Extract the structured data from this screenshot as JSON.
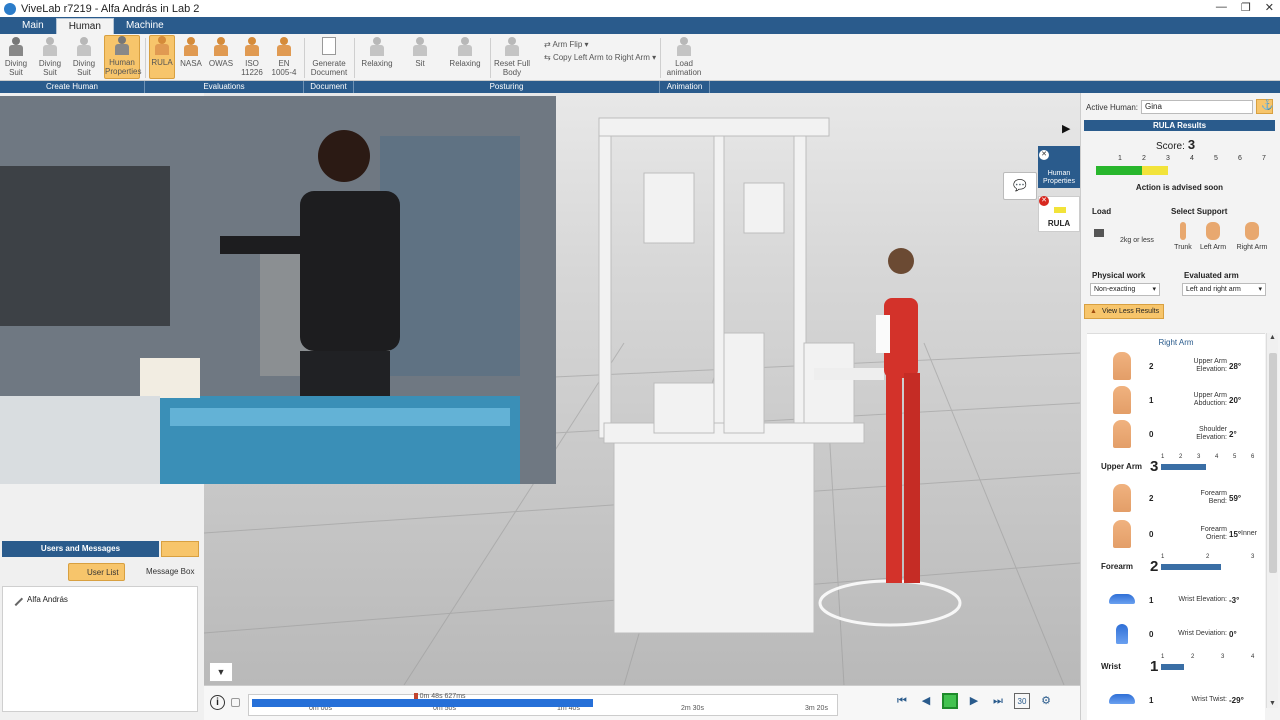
{
  "window": {
    "title": "ViveLab r7219 - Alfa András in Lab 2",
    "controls": [
      "—",
      "❐",
      "✕"
    ]
  },
  "tabs": [
    "Main",
    "Human",
    "Machine"
  ],
  "ribbon": {
    "create_human": [
      {
        "label": "Diving\nSuit"
      },
      {
        "label": "Diving\nSuit"
      },
      {
        "label": "Diving\nSuit"
      },
      {
        "label": "Human\nProperties"
      }
    ],
    "evaluations": [
      {
        "label": "RULA"
      },
      {
        "label": "NASA"
      },
      {
        "label": "OWAS"
      },
      {
        "label": "ISO\n11226"
      },
      {
        "label": "EN\n1005-4"
      }
    ],
    "document": [
      {
        "label": "Generate\nDocument"
      }
    ],
    "posturing": [
      {
        "label": "Relaxing"
      },
      {
        "label": "Sit"
      },
      {
        "label": "Relaxing"
      },
      {
        "label": "Reset Full\nBody"
      }
    ],
    "arm_flip_label": "Arm Flip",
    "copy_arm_label": "Copy Left Arm to Right Arm",
    "animation": [
      {
        "label": "Load\nanimation"
      }
    ]
  },
  "sections": [
    "Create Human",
    "Evaluations",
    "Document",
    "Posturing",
    "Animation"
  ],
  "users": {
    "header": "Users and Messages",
    "tabs": [
      "User List",
      "Message Box"
    ],
    "entries": [
      "Alfa András"
    ]
  },
  "timeline": {
    "current_time": "0m 48s 627ms",
    "ticks": [
      "0m 00s",
      "0m 50s",
      "1m 40s",
      "2m 30s",
      "3m 20s"
    ],
    "progress_fraction": 0.58,
    "playhead_fraction": 0.28,
    "speed_badge": "30"
  },
  "viewport_buttons": {
    "human_properties": "Human\nProperties",
    "rula": "RULA"
  },
  "rula": {
    "active_human_label": "Active Human:",
    "active_human": "Gina",
    "header": "RULA Results",
    "score_label": "Score:",
    "score": "3",
    "scale": [
      "1",
      "2",
      "3",
      "4",
      "5",
      "6",
      "7"
    ],
    "advice": "Action is advised soon",
    "load_label": "Load",
    "load_value": "2kg or less",
    "support_label": "Select Support",
    "supports": [
      "Trunk",
      "Left Arm",
      "Right Arm"
    ],
    "physical_work_label": "Physical work",
    "physical_work": "Non-exacting",
    "evaluated_arm_label": "Evaluated arm",
    "evaluated_arm": "Left and right arm",
    "view_less": "View Less Results",
    "section_title": "Right Arm",
    "rows": [
      {
        "score": "2",
        "label": "Upper Arm\nElevation:",
        "value": "28°",
        "extra": ""
      },
      {
        "score": "1",
        "label": "Upper Arm\nAbduction:",
        "value": "20°",
        "extra": ""
      },
      {
        "score": "0",
        "label": "Shoulder\nElevation:",
        "value": "2°",
        "extra": ""
      },
      {
        "score": "2",
        "label": "Forearm\nBend:",
        "value": "59°",
        "extra": ""
      },
      {
        "score": "0",
        "label": "Forearm\nOrient:",
        "value": "15°",
        "extra": "Inner"
      },
      {
        "score": "1",
        "label": "Wrist Elevation:",
        "value": "-3°",
        "extra": ""
      },
      {
        "score": "0",
        "label": "Wrist Deviation:",
        "value": "0°",
        "extra": ""
      },
      {
        "score": "1",
        "label": "Wrist Twist:",
        "value": "-29°",
        "extra": ""
      }
    ],
    "summaries": [
      {
        "label": "Upper Arm",
        "value": "3",
        "ticks": [
          "1",
          "2",
          "3",
          "4",
          "5",
          "6"
        ],
        "fraction": 0.5
      },
      {
        "label": "Forearm",
        "value": "2",
        "ticks": [
          "1",
          "2",
          "3"
        ],
        "fraction": 0.67
      },
      {
        "label": "Wrist",
        "value": "1",
        "ticks": [
          "1",
          "2",
          "3",
          "4"
        ],
        "fraction": 0.25
      }
    ]
  },
  "colors": {
    "brand": "#2a5b8c",
    "highlight": "#f7c56b",
    "green": "#28b62c",
    "yellow": "#f2e33a",
    "bar": "#3a6ea5"
  }
}
